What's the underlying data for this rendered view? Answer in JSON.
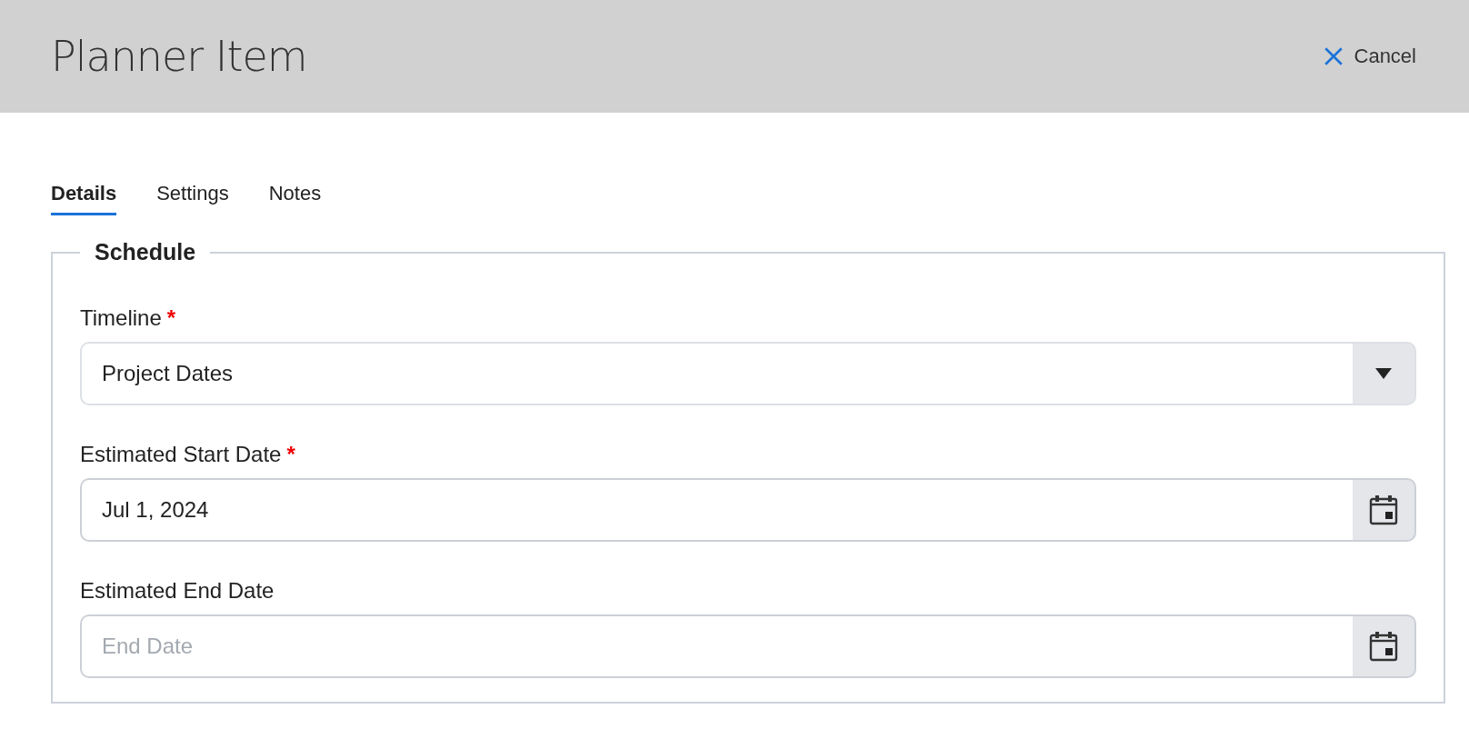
{
  "header": {
    "title": "Planner Item",
    "cancel": "Cancel"
  },
  "tabs": [
    {
      "label": "Details",
      "selected": true
    },
    {
      "label": "Settings",
      "selected": false
    },
    {
      "label": "Notes",
      "selected": false
    }
  ],
  "section": {
    "title": "Schedule",
    "fields": [
      {
        "kind": "select",
        "label": "Timeline",
        "required_mark": "*",
        "value": "Project Dates"
      },
      {
        "kind": "date",
        "label": "Estimated Start Date",
        "required_mark": "*",
        "value": "Jul 1, 2024"
      },
      {
        "kind": "date",
        "label": "Estimated End Date",
        "placeholder": "End Date"
      }
    ]
  }
}
